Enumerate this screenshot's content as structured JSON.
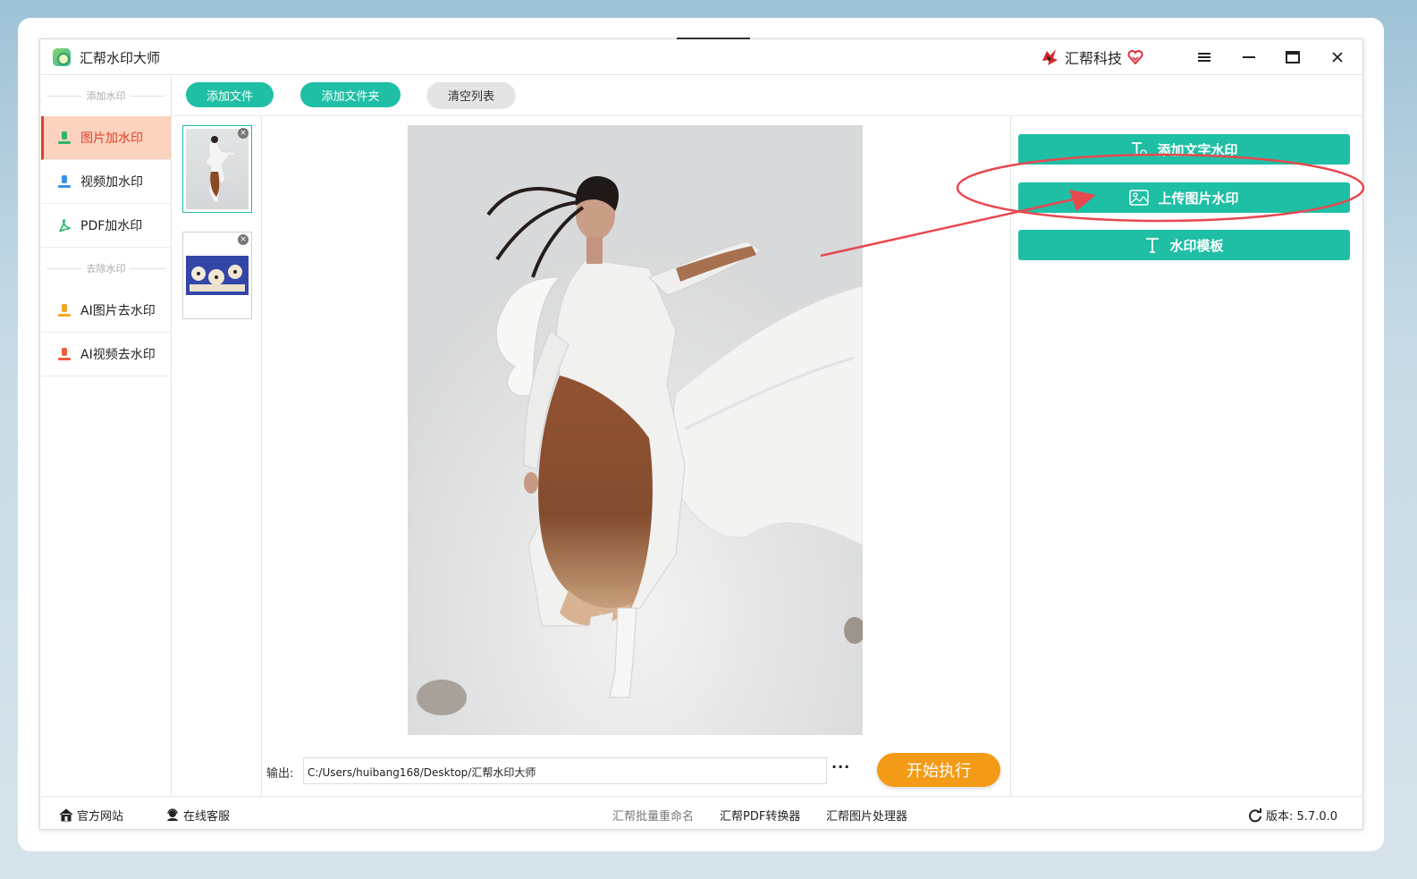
{
  "app": {
    "title": "汇帮水印大师",
    "brand_name": "汇帮科技",
    "icons": {
      "menu": "hamburger-icon",
      "minimize": "minimize-icon",
      "maximize": "maximize-icon",
      "close": "close-icon"
    }
  },
  "sidebar": {
    "section_add": "添加水印",
    "section_remove": "去除水印",
    "items": [
      {
        "label": "图片加水印",
        "active": true,
        "icon": "image-upload-icon"
      },
      {
        "label": "视频加水印",
        "active": false,
        "icon": "video-upload-icon"
      },
      {
        "label": "PDF加水印",
        "active": false,
        "icon": "pdf-icon"
      },
      {
        "label": "AI图片去水印",
        "active": false,
        "icon": "ai-image-icon"
      },
      {
        "label": "AI视频去水印",
        "active": false,
        "icon": "ai-video-icon"
      }
    ]
  },
  "toolbar": {
    "add_file": "添加文件",
    "add_folder": "添加文件夹",
    "clear_list": "清空列表"
  },
  "thumbnails": {
    "close_glyph": "×",
    "items": [
      {
        "name": "fashion-photo-thumbnail",
        "selected": true
      },
      {
        "name": "cartoon-thumbnail",
        "selected": false
      }
    ]
  },
  "output": {
    "label": "输出:",
    "path": "C:/Users/huibang168/Desktop/汇帮水印大师",
    "more": "···",
    "start": "开始执行"
  },
  "right_panel": {
    "add_text_watermark": "添加文字水印",
    "upload_image_watermark": "上传图片水印",
    "watermark_template": "水印模板"
  },
  "status": {
    "official_site": "官方网站",
    "online_service": "在线客服",
    "batch_rename": "汇帮批量重命名",
    "pdf_converter": "汇帮PDF转换器",
    "image_processor": "汇帮图片处理器",
    "version": "版本:  5.7.0.0"
  },
  "colors": {
    "accent_teal": "#1fbfa5",
    "active_bg": "#fbd2bd",
    "active_text": "#e3402a",
    "start_orange": "#f39a16",
    "annotation_red": "#e8484f"
  }
}
